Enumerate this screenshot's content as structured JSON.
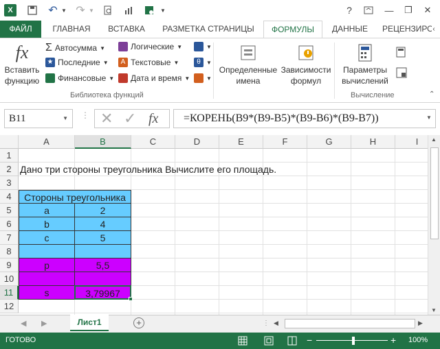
{
  "titlebar": {
    "help": "?",
    "minimize": "—",
    "restore": "❐",
    "close": "✕"
  },
  "tabs": [
    {
      "label": "ФАЙЛ"
    },
    {
      "label": "ГЛАВНАЯ"
    },
    {
      "label": "ВСТАВКА"
    },
    {
      "label": "РАЗМЕТКА СТРАНИЦЫ"
    },
    {
      "label": "ФОРМУЛЫ"
    },
    {
      "label": "ДАННЫЕ"
    },
    {
      "label": "РЕЦЕНЗИРО"
    }
  ],
  "ribbon": {
    "insert_function": "Вставить\nфункцию",
    "autosum": "Автосумма",
    "recent": "Последние",
    "financial": "Финансовые",
    "logical": "Логические",
    "text": "Текстовые",
    "datetime": "Дата и время",
    "library_label": "Библиотека функций",
    "defined_names": "Определенные\nимена",
    "dependencies": "Зависимости\nформул",
    "calc_options": "Параметры\nвычислений",
    "calc_label": "Вычисление"
  },
  "formula_bar": {
    "name_box": "B11",
    "formula": "=КОРЕНЬ(B9*(B9-B5)*(B9-B6)*(B9-B7))",
    "fx": "fx"
  },
  "columns": [
    "A",
    "B",
    "C",
    "D",
    "E",
    "F",
    "G",
    "H",
    "I"
  ],
  "rows": [
    "1",
    "2",
    "3",
    "4",
    "5",
    "6",
    "7",
    "8",
    "9",
    "10",
    "11",
    "12"
  ],
  "cells": {
    "a2": "Дано три стороны треугольника Вычислите его площадь.",
    "a4": "Стороны треугольника",
    "a5": "a",
    "b5": "2",
    "a6": "b",
    "b6": "4",
    "a7": "c",
    "b7": "5",
    "a9": "p",
    "b9": "5,5",
    "a11": "s",
    "b11": "3,79967"
  },
  "sheet_tab": "Лист1",
  "status": {
    "ready": "ГОТОВО",
    "zoom": "100%"
  },
  "colors": {
    "accent": "#217346",
    "blue": "#66ccff",
    "magenta": "#cc00ff"
  }
}
